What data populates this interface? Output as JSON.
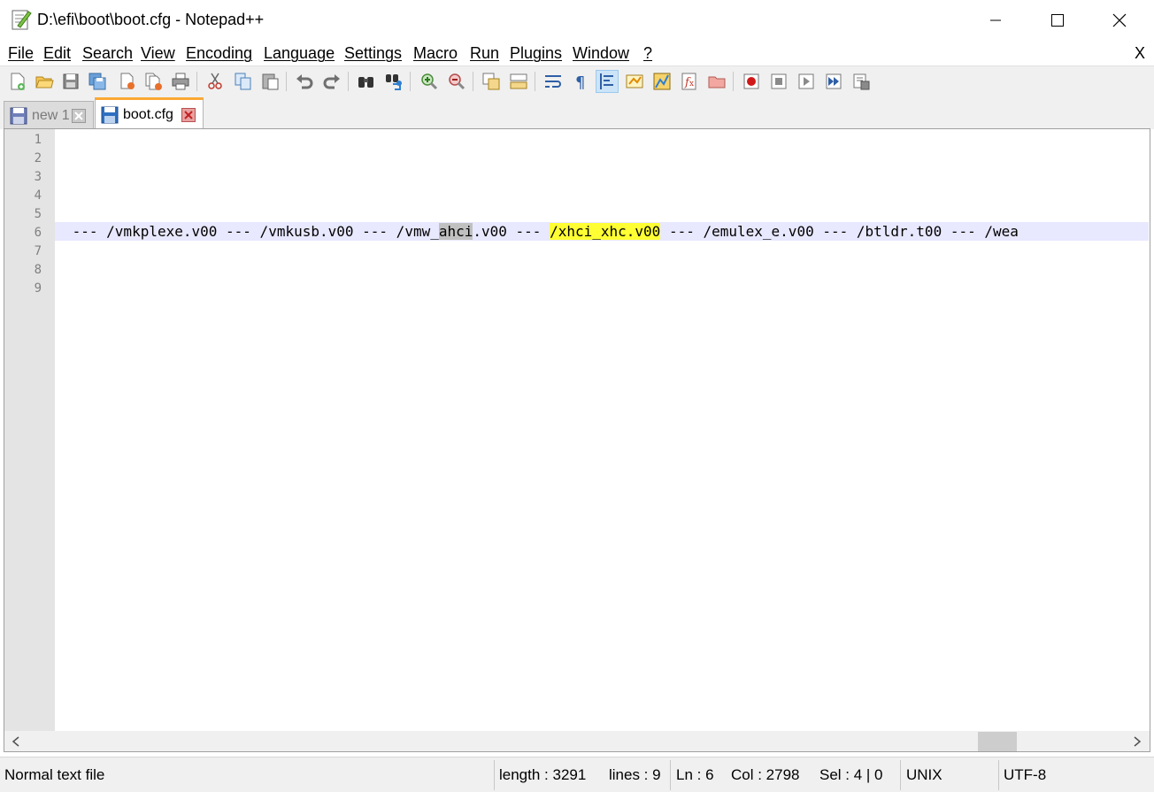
{
  "window": {
    "title": "D:\\efi\\boot\\boot.cfg - Notepad++"
  },
  "menu": {
    "items": [
      "File",
      "Edit",
      "Search",
      "View",
      "Encoding",
      "Language",
      "Settings",
      "Macro",
      "Run",
      "Plugins",
      "Window",
      "?"
    ],
    "close_label": "X"
  },
  "toolbar": {
    "icons": [
      "new-file-icon",
      "open-file-icon",
      "save-icon",
      "save-all-icon",
      "close-icon",
      "close-all-icon",
      "print-icon",
      "cut-icon",
      "copy-icon",
      "paste-icon",
      "undo-icon",
      "redo-icon",
      "find-icon",
      "replace-icon",
      "zoom-in-icon",
      "zoom-out-icon",
      "sync-vertical-icon",
      "sync-horizontal-icon",
      "word-wrap-icon",
      "show-all-chars-icon",
      "indent-guide-icon",
      "doc-map-icon",
      "function-list-icon",
      "folder-as-workspace-icon",
      "monitoring-icon",
      "macro-record-icon",
      "macro-stop-icon",
      "macro-play-icon",
      "macro-run-multiple-icon",
      "macro-save-icon"
    ]
  },
  "tabs": [
    {
      "label": "new 1",
      "active": false
    },
    {
      "label": "boot.cfg",
      "active": true
    }
  ],
  "editor": {
    "line_numbers": [
      "1",
      "2",
      "3",
      "4",
      "5",
      "6",
      "7",
      "8",
      "9"
    ],
    "current_line": "6",
    "line6": {
      "seg1": " --- /vmkplexe.v00 --- /vmkusb.v00 --- /vmw_",
      "match_gray": "ahci",
      "seg2": ".v00 --- ",
      "match_yellow": "/xhci_xhc.v00",
      "seg3": " --- /emulex_e.v00 --- /btldr.t00 --- /wea"
    },
    "colors": {
      "gutter": "#e4e4e4",
      "current_line": "#e8e8ff",
      "highlight_yellow": "#ffff33",
      "highlight_gray": "#c0c0c0",
      "active_tab_accent": "#fba834"
    }
  },
  "statusbar": {
    "file_type": "Normal text file",
    "length": "length : 3291",
    "lines": "lines : 9",
    "ln": "Ln : 6",
    "col": "Col : 2798",
    "sel": "Sel : 4 | 0",
    "eol": "UNIX",
    "encoding": "UTF-8"
  }
}
